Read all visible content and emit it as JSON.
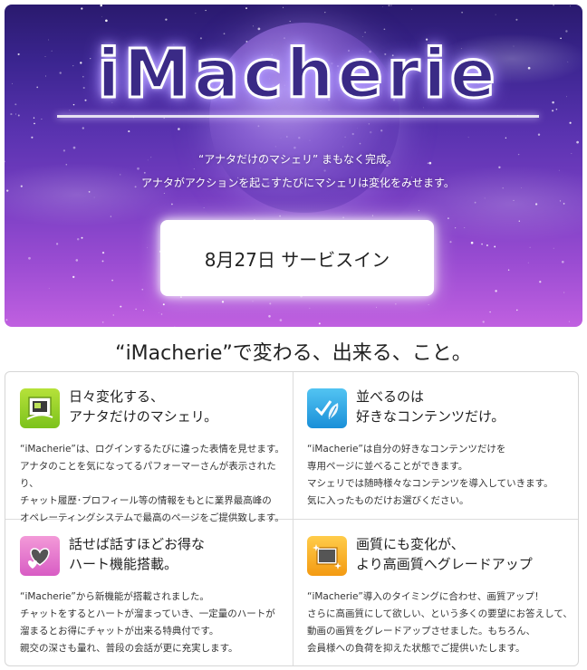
{
  "hero": {
    "logo": "iMacherie",
    "tagline_line1": "“アナタだけのマシェリ” まもなく完成。",
    "tagline_line2": "アナタがアクションを起こすたびにマシェリは変化をみせます。",
    "launch_date": "8月27日 サービスイン"
  },
  "headline": "“iMacherie”で変わる、出来る、こと。",
  "colors": {
    "hero_top": "#2a1a6e",
    "hero_bottom": "#c060e0",
    "icon_green": "#7cc21c",
    "icon_blue": "#1a8fd8",
    "icon_pink": "#d85cc4",
    "icon_orange": "#f39a12"
  },
  "features": [
    {
      "icon": "photo-frame-icon",
      "title_line1": "日々変化する、",
      "title_line2": "アナタだけのマシェリ。",
      "body": [
        "“iMacherie”は、ログインするたびに違った表情を見せます。",
        "アナタのことを気になってるパフォーマーさんが表示されたり、",
        "チャット履歴･プロフィール等の情報をもとに業界最高峰の",
        "オペレーティングシステムで最高のページをご提供致します。"
      ]
    },
    {
      "icon": "checkmark-leaf-icon",
      "title_line1": "並べるのは",
      "title_line2": "好きなコンテンツだけ。",
      "body": [
        "“iMacherie”は自分の好きなコンテンツだけを",
        "専用ページに並べることができます。",
        "マシェリでは随時様々なコンテンツを導入していきます。",
        "気に入ったものだけお選びください。"
      ]
    },
    {
      "icon": "hearts-icon",
      "title_line1": "話せば話すほどお得な",
      "title_line2": "ハート機能搭載。",
      "body": [
        "“iMacherie”から新機能が搭載されました。",
        "チャットをするとハートが溜まっていき、一定量のハートが",
        "溜まるとお得にチャットが出来る特典付です。",
        "親交の深さも量れ、普段の会話が更に充実します。"
      ]
    },
    {
      "icon": "sparkle-screen-icon",
      "title_line1": "画質にも変化が、",
      "title_line2": "より高画質へグレードアップ",
      "body": [
        "“iMacherie”導入のタイミングに合わせ、画質アップ！",
        "さらに高画質にして欲しい、という多くの要望にお答えして、",
        "動画の画質をグレードアップさせました。もちろん、",
        "会員様への負荷を抑えた状態でご提供いたします。"
      ]
    }
  ]
}
